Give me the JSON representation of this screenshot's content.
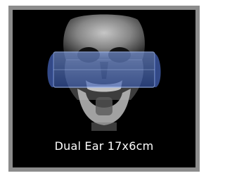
{
  "option": {
    "caption": "Dual Ear 17x6cm",
    "preview_icon": "skull-xray-icon",
    "scan_region_icon": "scan-region-band-icon"
  },
  "colors": {
    "frame": "#8c8c8c",
    "background": "#000000",
    "caption_text": "#ffffff",
    "scan_band": "#5c82d6"
  }
}
